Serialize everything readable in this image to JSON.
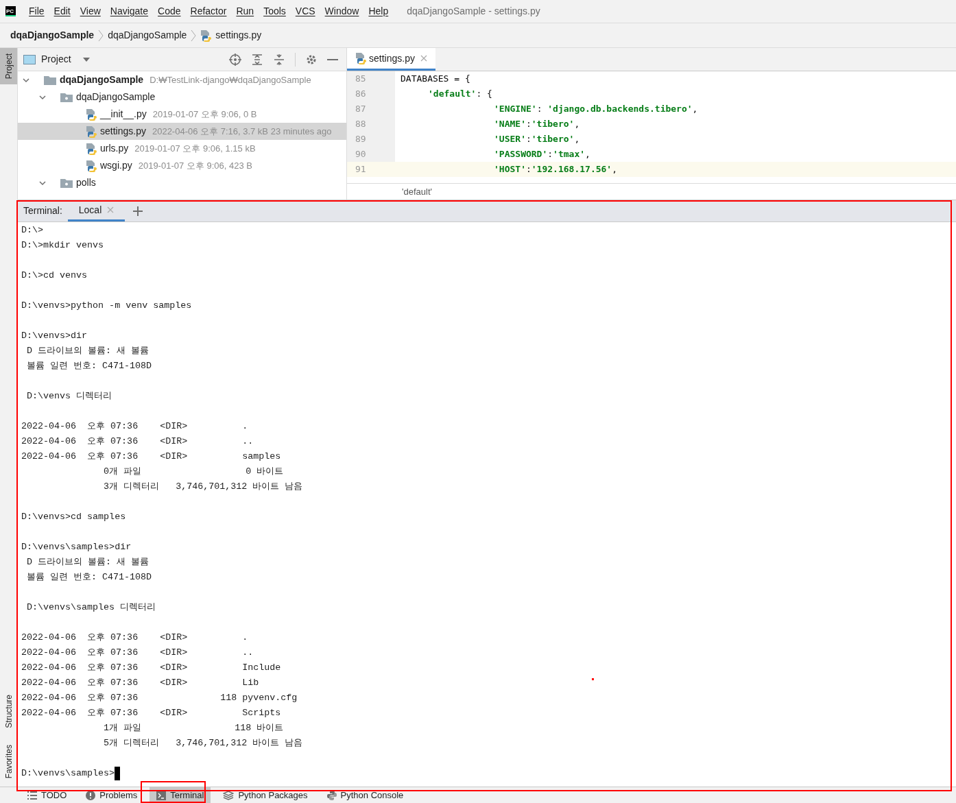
{
  "menu_bar": {
    "logo": "PC",
    "items": [
      "File",
      "Edit",
      "View",
      "Navigate",
      "Code",
      "Refactor",
      "Run",
      "Tools",
      "VCS",
      "Window",
      "Help"
    ],
    "title": "dqaDjangoSample - settings.py"
  },
  "breadcrumb": [
    {
      "text": "dqaDjangoSample",
      "kind": "root"
    },
    {
      "text": "dqaDjangoSample",
      "kind": "folder"
    },
    {
      "text": "settings.py",
      "kind": "file"
    }
  ],
  "left_strip": {
    "top": [
      "Project"
    ],
    "bottom": [
      "Structure",
      "Favorites"
    ]
  },
  "project_panel": {
    "title": "Project",
    "tree": [
      {
        "name": "dqaDjangoSample",
        "meta": "D:₩TestLink-django₩dqaDjangoSample",
        "kind": "root",
        "expanded": true,
        "selected": false,
        "children": [
          {
            "name": "dqaDjangoSample",
            "kind": "package",
            "expanded": true,
            "selected": false,
            "children": [
              {
                "name": "__init__.py",
                "meta": "2019-01-07 오후 9:06, 0 B",
                "kind": "python",
                "selected": false
              },
              {
                "name": "settings.py",
                "meta": "2022-04-06 오후 7:16, 3.7 kB 23 minutes ago",
                "kind": "python",
                "selected": true
              },
              {
                "name": "urls.py",
                "meta": "2019-01-07 오후 9:06, 1.15 kB",
                "kind": "python",
                "selected": false
              },
              {
                "name": "wsgi.py",
                "meta": "2019-01-07 오후 9:06, 423 B",
                "kind": "python",
                "selected": false
              }
            ]
          },
          {
            "name": "polls",
            "kind": "package",
            "expanded": true,
            "selected": false
          }
        ]
      }
    ]
  },
  "editor": {
    "tab": {
      "label": "settings.py",
      "selected": true
    },
    "lines": [
      {
        "number": "85",
        "current": false,
        "tokens": [
          {
            "text": "DATABASES = {",
            "kind": "plain"
          }
        ],
        "children": [
          {
            "number": "86",
            "current": false,
            "tokens": [
              {
                "text": "'default'",
                "kind": "string"
              },
              {
                "text": ": {",
                "kind": "plain"
              }
            ],
            "children": [
              {
                "number": "87",
                "current": false,
                "tokens": [
                  {
                    "text": "'ENGINE'",
                    "kind": "string"
                  },
                  {
                    "text": ": ",
                    "kind": "plain"
                  },
                  {
                    "text": "'django.db.backends.tibero'",
                    "kind": "string"
                  },
                  {
                    "text": ",",
                    "kind": "plain"
                  }
                ]
              },
              {
                "number": "88",
                "current": false,
                "tokens": [
                  {
                    "text": "'NAME'",
                    "kind": "string"
                  },
                  {
                    "text": ":",
                    "kind": "plain"
                  },
                  {
                    "text": "'tibero'",
                    "kind": "string"
                  },
                  {
                    "text": ",",
                    "kind": "plain"
                  }
                ]
              },
              {
                "number": "89",
                "current": false,
                "tokens": [
                  {
                    "text": "'USER'",
                    "kind": "string"
                  },
                  {
                    "text": ":",
                    "kind": "plain"
                  },
                  {
                    "text": "'tibero'",
                    "kind": "string"
                  },
                  {
                    "text": ",",
                    "kind": "plain"
                  }
                ]
              },
              {
                "number": "90",
                "current": false,
                "tokens": [
                  {
                    "text": "'PASSWORD'",
                    "kind": "string"
                  },
                  {
                    "text": ":",
                    "kind": "plain"
                  },
                  {
                    "text": "'tmax'",
                    "kind": "string"
                  },
                  {
                    "text": ",",
                    "kind": "plain"
                  }
                ]
              },
              {
                "number": "91",
                "current": true,
                "tokens": [
                  {
                    "text": "'HOST'",
                    "kind": "string"
                  },
                  {
                    "text": ":",
                    "kind": "plain"
                  },
                  {
                    "text": "'192.168.17.56'",
                    "kind": "string"
                  },
                  {
                    "text": ",",
                    "kind": "plain"
                  }
                ]
              }
            ]
          }
        ]
      }
    ],
    "breadcrumb": "'default'"
  },
  "terminal": {
    "label": "Terminal:",
    "tabs": [
      {
        "label": "Local",
        "selected": true
      }
    ],
    "blocks": [
      [
        "D:\\>",
        "D:\\>mkdir venvs"
      ],
      [
        "D:\\>cd venvs"
      ],
      [
        "D:\\venvs>python -m venv samples"
      ],
      [
        "D:\\venvs>dir",
        " D 드라이브의 볼륨: 새 볼륨",
        " 볼륨 일련 번호: C471-108D"
      ],
      [
        " D:\\venvs 디렉터리"
      ],
      [
        "2022-04-06  오후 07:36    <DIR>          .",
        "2022-04-06  오후 07:36    <DIR>          ..",
        "2022-04-06  오후 07:36    <DIR>          samples",
        "               0개 파일                   0 바이트",
        "               3개 디렉터리   3,746,701,312 바이트 남음"
      ],
      [
        "D:\\venvs>cd samples"
      ],
      [
        "D:\\venvs\\samples>dir",
        " D 드라이브의 볼륨: 새 볼륨",
        " 볼륨 일련 번호: C471-108D"
      ],
      [
        " D:\\venvs\\samples 디렉터리"
      ],
      [
        "2022-04-06  오후 07:36    <DIR>          .",
        "2022-04-06  오후 07:36    <DIR>          ..",
        "2022-04-06  오후 07:36    <DIR>          Include",
        "2022-04-06  오후 07:36    <DIR>          Lib",
        "2022-04-06  오후 07:36               118 pyvenv.cfg",
        "2022-04-06  오후 07:36    <DIR>          Scripts",
        "               1개 파일                 118 바이트",
        "               5개 디렉터리   3,746,701,312 바이트 남음"
      ],
      [
        "D:\\venvs\\samples>"
      ]
    ]
  },
  "bottom_bar": [
    {
      "label": "TODO",
      "kind": "list",
      "selected": false
    },
    {
      "label": "Problems",
      "kind": "problems",
      "selected": false
    },
    {
      "label": "Terminal",
      "kind": "terminal",
      "selected": true
    },
    {
      "label": "Python Packages",
      "kind": "packages",
      "selected": false
    },
    {
      "label": "Python Console",
      "kind": "python",
      "selected": false
    }
  ]
}
